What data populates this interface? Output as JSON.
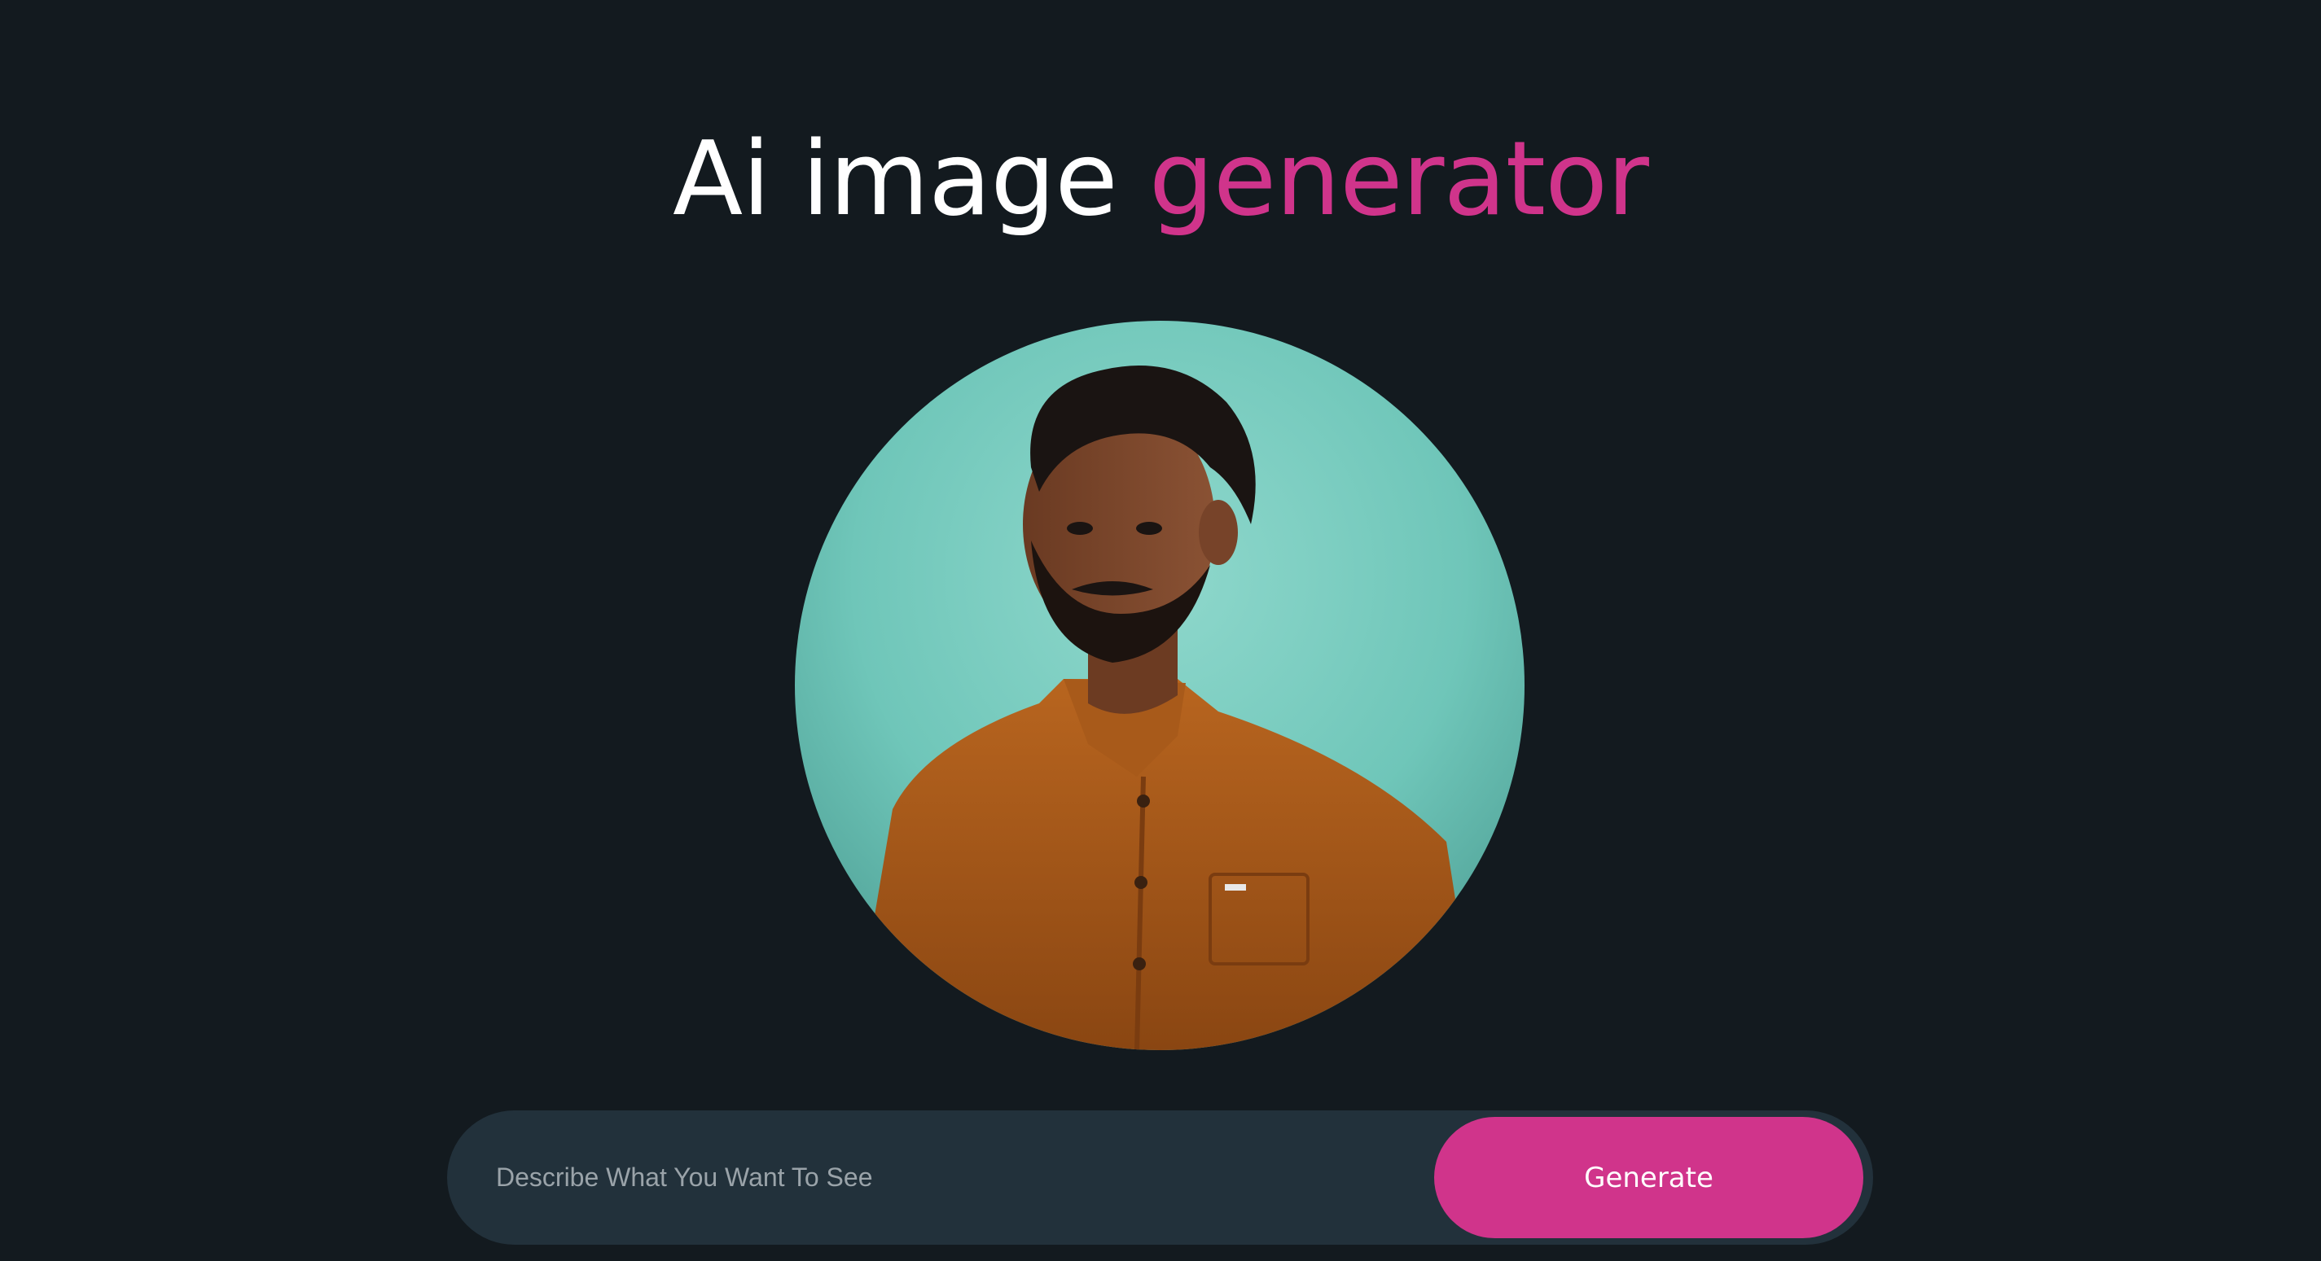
{
  "header": {
    "title_main": "Ai image ",
    "title_accent": "generator",
    "accent_color": "#d0348b"
  },
  "image": {
    "alt": "Portrait of a man in an orange shirt against a teal wall"
  },
  "prompt": {
    "placeholder": "Describe What You Want To See",
    "value": "",
    "button_label": "Generate"
  },
  "colors": {
    "background": "#131a1f",
    "bar": "#22313b",
    "button": "#d0348b"
  }
}
